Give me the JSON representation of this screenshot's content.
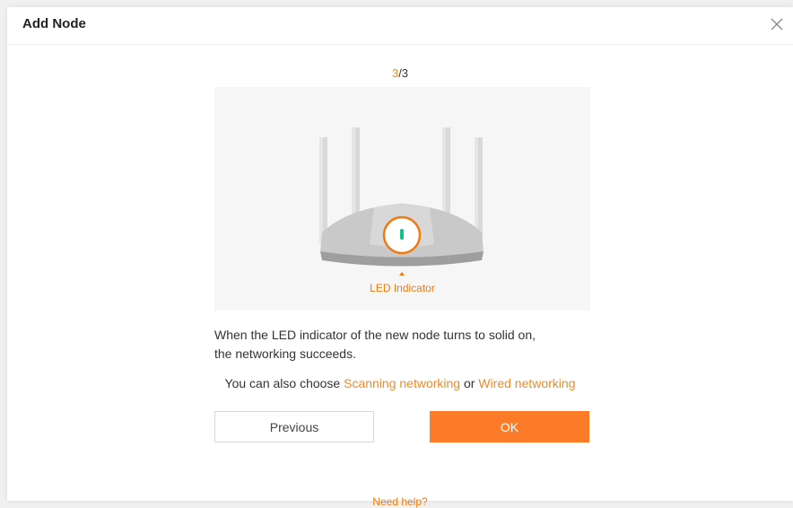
{
  "dialog": {
    "title": "Add Node",
    "close_icon": "close-icon"
  },
  "step": {
    "current": "3",
    "total": "/3"
  },
  "illustration": {
    "led_label": "LED Indicator"
  },
  "description": {
    "line1": "When the LED indicator of the new node turns to solid on,",
    "line2": "the networking succeeds."
  },
  "alternatives": {
    "prefix": "You can also choose ",
    "scanning_link": "Scanning networking",
    "or_text": " or ",
    "wired_link": "Wired networking"
  },
  "buttons": {
    "previous": "Previous",
    "ok": "OK"
  },
  "help_link": "Need help?",
  "colors": {
    "accent": "#fb7b29",
    "link": "#f08a24",
    "led": "#16c08a"
  }
}
